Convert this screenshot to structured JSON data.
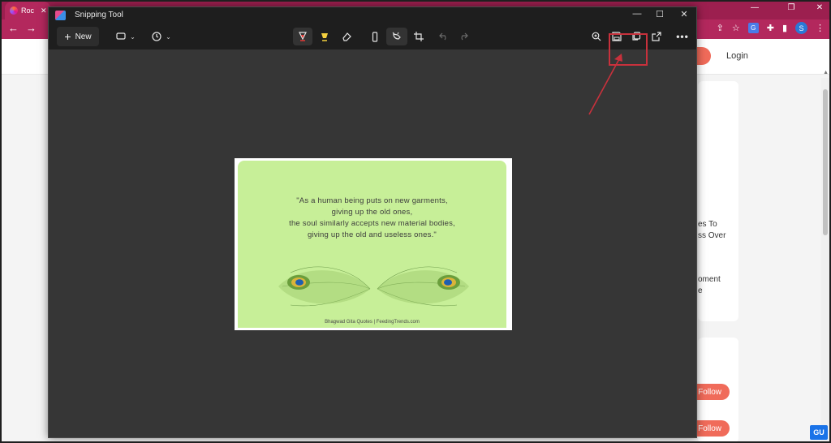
{
  "browser": {
    "tab_title": "Roc",
    "profile_initial": "S"
  },
  "website": {
    "login": "Login",
    "card1_lines": [
      "es To",
      "ss Over",
      "",
      "",
      "oment",
      "e"
    ],
    "follow_label": "Follow",
    "watermark": "GU"
  },
  "snipping_tool": {
    "title": "Snipping Tool",
    "new_button": "New",
    "quote": {
      "lines": [
        "\"As a human being puts on new garments,",
        "giving up the old ones,",
        "the soul similarly accepts new material bodies,",
        "giving up the old and useless ones.\""
      ],
      "footer": "Bhagwad Gita Quotes | FeedingTrends.com"
    }
  },
  "colors": {
    "browser_accent": "#b3285d",
    "card_green": "#c7ef98",
    "highlight_red": "#c8313c",
    "follow_orange": "#f06b5a"
  },
  "icons": {
    "rect_snip": "rectangle-snip-icon",
    "delay": "clock-icon",
    "pen": "ballpoint-pen-icon",
    "highlighter": "highlighter-icon",
    "eraser": "eraser-icon",
    "ruler": "ruler-icon",
    "touch": "touch-writing-icon",
    "crop": "crop-icon",
    "undo": "undo-icon",
    "redo": "redo-icon",
    "zoom": "zoom-in-icon",
    "save": "save-icon",
    "copy": "copy-icon",
    "share": "share-icon",
    "more": "more-icon"
  }
}
